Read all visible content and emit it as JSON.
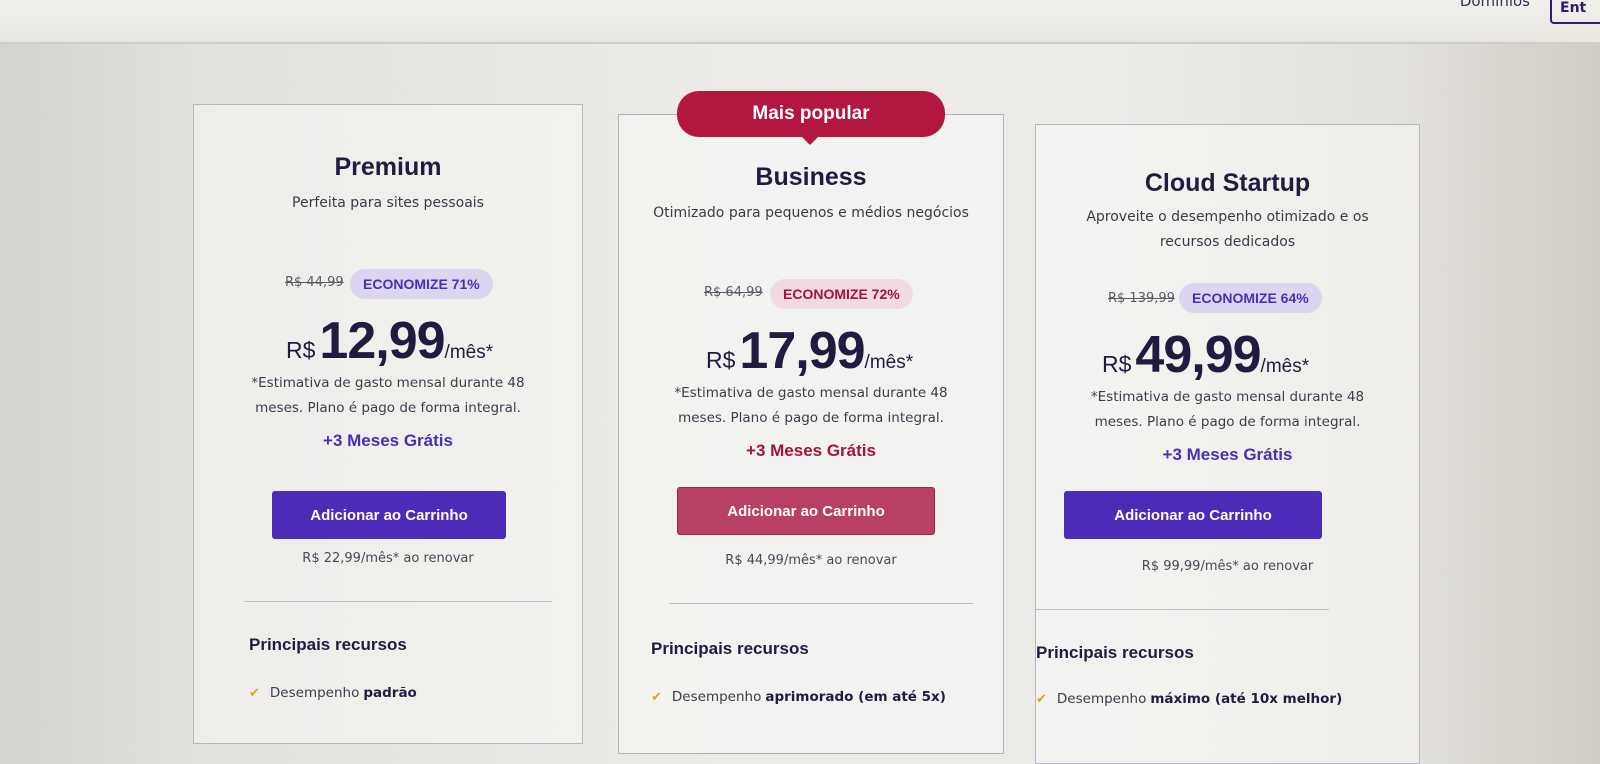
{
  "header": {
    "top_link": "Domínios",
    "top_button": "Ent"
  },
  "popular_badge": "Mais popular",
  "plans": [
    {
      "name": "Premium",
      "subtitle": "Perfeita para sites pessoais",
      "old_price": "R$ 44,99",
      "save": "ECONOMIZE 71%",
      "currency": "R$",
      "price": "12,99",
      "per": "/mês*",
      "note": "*Estimativa de gasto mensal durante 48 meses. Plano é pago de forma integral.",
      "bonus": "+3 Meses Grátis",
      "cta": "Adicionar ao Carrinho",
      "renew": "R$ 22,99/mês* ao renovar",
      "features_title": "Principais recursos",
      "features": [
        {
          "text": "Desempenho",
          "bold": "padrão"
        }
      ],
      "accent": "#4b2bb8"
    },
    {
      "name": "Business",
      "subtitle": "Otimizado para pequenos e médios negócios",
      "old_price": "R$ 64,99",
      "save": "ECONOMIZE 72%",
      "currency": "R$",
      "price": "17,99",
      "per": "/mês*",
      "note": "*Estimativa de gasto mensal durante 48 meses. Plano é pago de forma integral.",
      "bonus": "+3 Meses Grátis",
      "cta": "Adicionar ao Carrinho",
      "renew": "R$ 44,99/mês* ao renovar",
      "features_title": "Principais recursos",
      "features": [
        {
          "text": "Desempenho",
          "bold": "aprimorado (em até 5x)"
        }
      ],
      "accent": "#b3163e"
    },
    {
      "name": "Cloud Startup",
      "subtitle": "Aproveite o desempenho otimizado e os recursos dedicados",
      "old_price": "R$ 139,99",
      "save": "ECONOMIZE 64%",
      "currency": "R$",
      "price": "49,99",
      "per": "/mês*",
      "note": "*Estimativa de gasto mensal durante 48 meses. Plano é pago de forma integral.",
      "bonus": "+3 Meses Grátis",
      "cta": "Adicionar ao Carrinho",
      "renew": "R$ 99,99/mês* ao renovar",
      "features_title": "Principais recursos",
      "features": [
        {
          "text": "Desempenho",
          "bold": "máximo (até 10x melhor)"
        }
      ],
      "accent": "#4b2bb8"
    }
  ]
}
